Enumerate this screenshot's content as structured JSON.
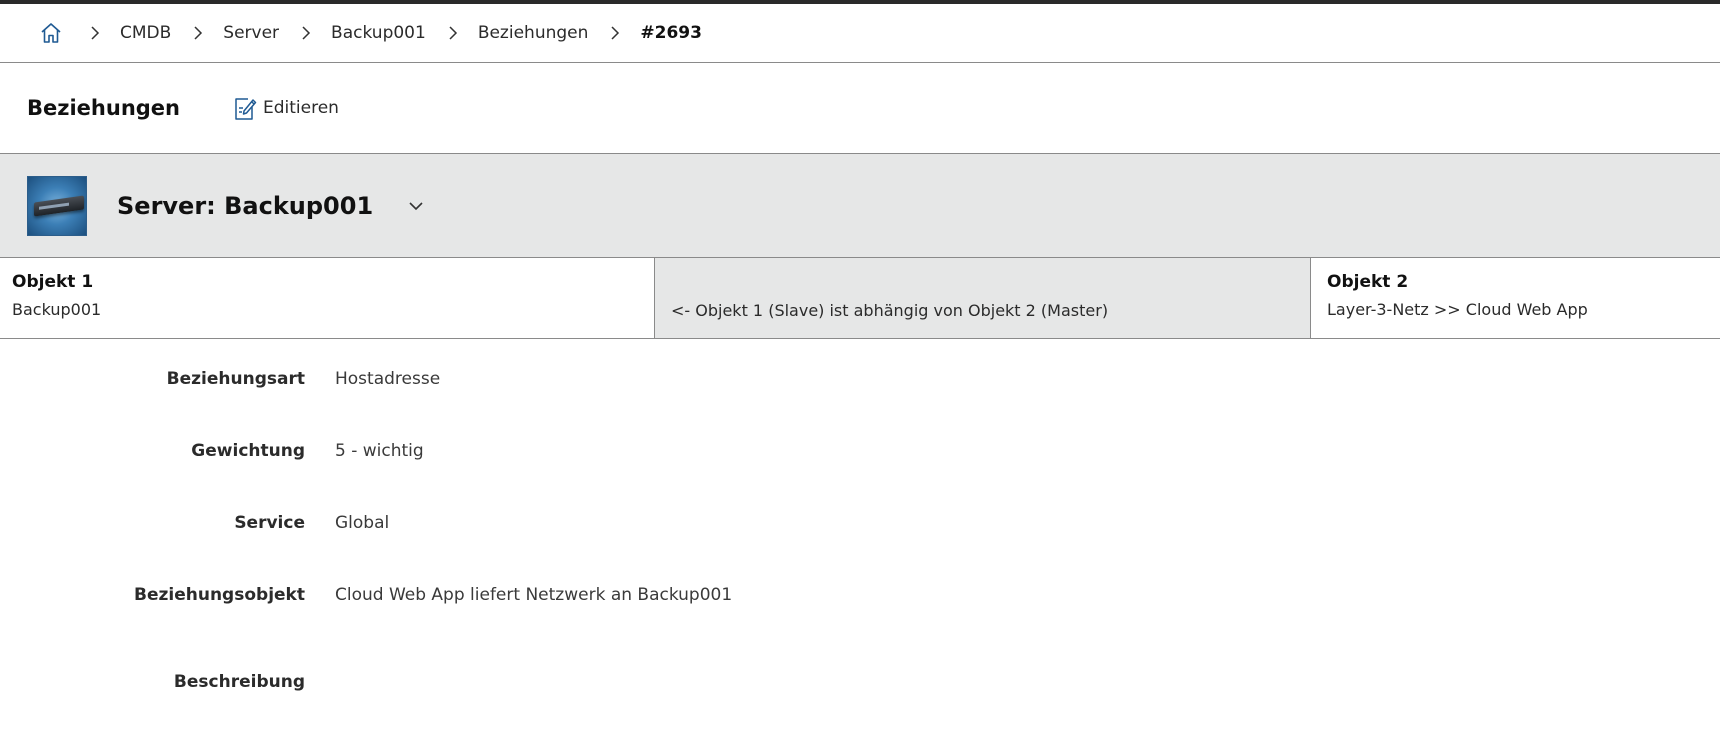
{
  "breadcrumb": {
    "items": [
      "CMDB",
      "Server",
      "Backup001",
      "Beziehungen"
    ],
    "current": "#2693"
  },
  "toolbar": {
    "title": "Beziehungen",
    "edit_label": "Editieren"
  },
  "object_header": {
    "title": "Server: Backup001"
  },
  "relation": {
    "object1_label": "Objekt 1",
    "object1_value": "Backup001",
    "description": "<- Objekt 1 (Slave) ist abhängig von Objekt 2 (Master)",
    "object2_label": "Objekt 2",
    "object2_value": "Layer-3-Netz >> Cloud Web App"
  },
  "details": [
    {
      "label": "Beziehungsart",
      "value": "Hostadresse"
    },
    {
      "label": "Gewichtung",
      "value": "5 - wichtig"
    },
    {
      "label": "Service",
      "value": "Global"
    },
    {
      "label": "Beziehungsobjekt",
      "value": "Cloud Web App liefert Netzwerk an Backup001"
    },
    {
      "label": "Beschreibung",
      "value": ""
    }
  ]
}
